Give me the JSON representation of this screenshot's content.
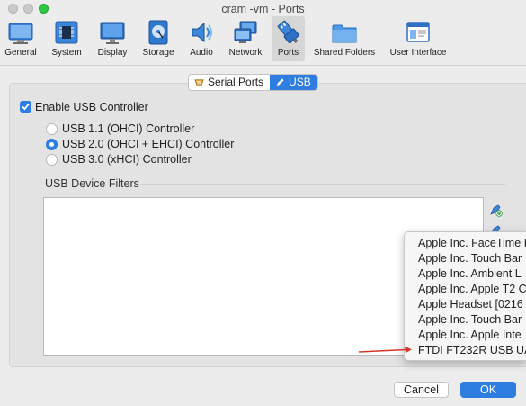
{
  "window": {
    "title": "cram -vm - Ports"
  },
  "toolbar": {
    "items": [
      {
        "label": "General",
        "icon": "general-icon"
      },
      {
        "label": "System",
        "icon": "system-chip-icon"
      },
      {
        "label": "Display",
        "icon": "display-monitor-icon"
      },
      {
        "label": "Storage",
        "icon": "storage-disk-icon"
      },
      {
        "label": "Audio",
        "icon": "audio-speaker-icon"
      },
      {
        "label": "Network",
        "icon": "network-icon"
      },
      {
        "label": "Ports",
        "icon": "ports-usb-icon",
        "active": true
      },
      {
        "label": "Shared Folders",
        "icon": "folder-icon"
      },
      {
        "label": "User Interface",
        "icon": "user-interface-icon"
      }
    ]
  },
  "tabs": [
    {
      "label": "Serial Ports",
      "icon": "serial-port-icon",
      "active": false
    },
    {
      "label": "USB",
      "icon": "pencil-icon",
      "active": true
    }
  ],
  "usb": {
    "enable_label": "Enable USB Controller",
    "enabled": true,
    "controllers": [
      {
        "label": "USB 1.1 (OHCI) Controller",
        "selected": false
      },
      {
        "label": "USB 2.0 (OHCI + EHCI) Controller",
        "selected": true
      },
      {
        "label": "USB 3.0 (xHCI) Controller",
        "selected": false
      }
    ],
    "filters_label": "USB Device Filters"
  },
  "device_menu": {
    "items": [
      "Apple Inc. FaceTime I",
      "Apple Inc. Touch Bar",
      "Apple Inc. Ambient L",
      "Apple Inc. Apple T2 C",
      "Apple Headset [0216",
      "Apple Inc. Touch Bar",
      "Apple Inc. Apple Inte",
      "FTDI FT232R USB UA"
    ]
  },
  "buttons": {
    "cancel": "Cancel",
    "ok": "OK"
  },
  "colors": {
    "accent": "#2e7de1",
    "arrow": "#d9362b"
  }
}
